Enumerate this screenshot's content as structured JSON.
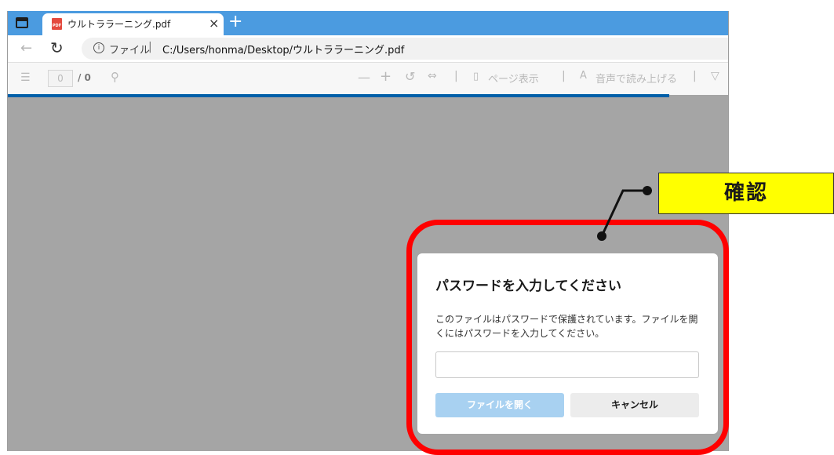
{
  "tab": {
    "title": "ウルトララーニング.pdf",
    "close": "×",
    "new_tab": "+"
  },
  "address": {
    "site_label": "ファイル",
    "separator": "|",
    "url": "C:/Users/honma/Desktop/ウルトララーニング.pdf"
  },
  "pdf_toolbar": {
    "page_current": "0",
    "page_total": "/ 0",
    "page_view_label": "ページ表示",
    "read_aloud_label": "音声で読み上げる"
  },
  "dialog": {
    "title": "パスワードを入力してください",
    "message": "このファイルはパスワードで保護されています。ファイルを開くにはパスワードを入力してください。",
    "password_value": "",
    "open_button": "ファイルを開く",
    "cancel_button": "キャンセル"
  },
  "annotation": {
    "callout_text": "確認",
    "highlight_color": "#ff0000",
    "callout_color": "#ffff00"
  },
  "icons": [
    "tab-actions-icon",
    "pdf-file-icon",
    "back-arrow-icon",
    "refresh-icon",
    "info-icon",
    "table-of-contents-icon",
    "search-icon",
    "zoom-out-icon",
    "zoom-in-icon",
    "rotate-icon",
    "fit-width-icon",
    "page-view-icon",
    "read-aloud-icon",
    "draw-icon"
  ]
}
